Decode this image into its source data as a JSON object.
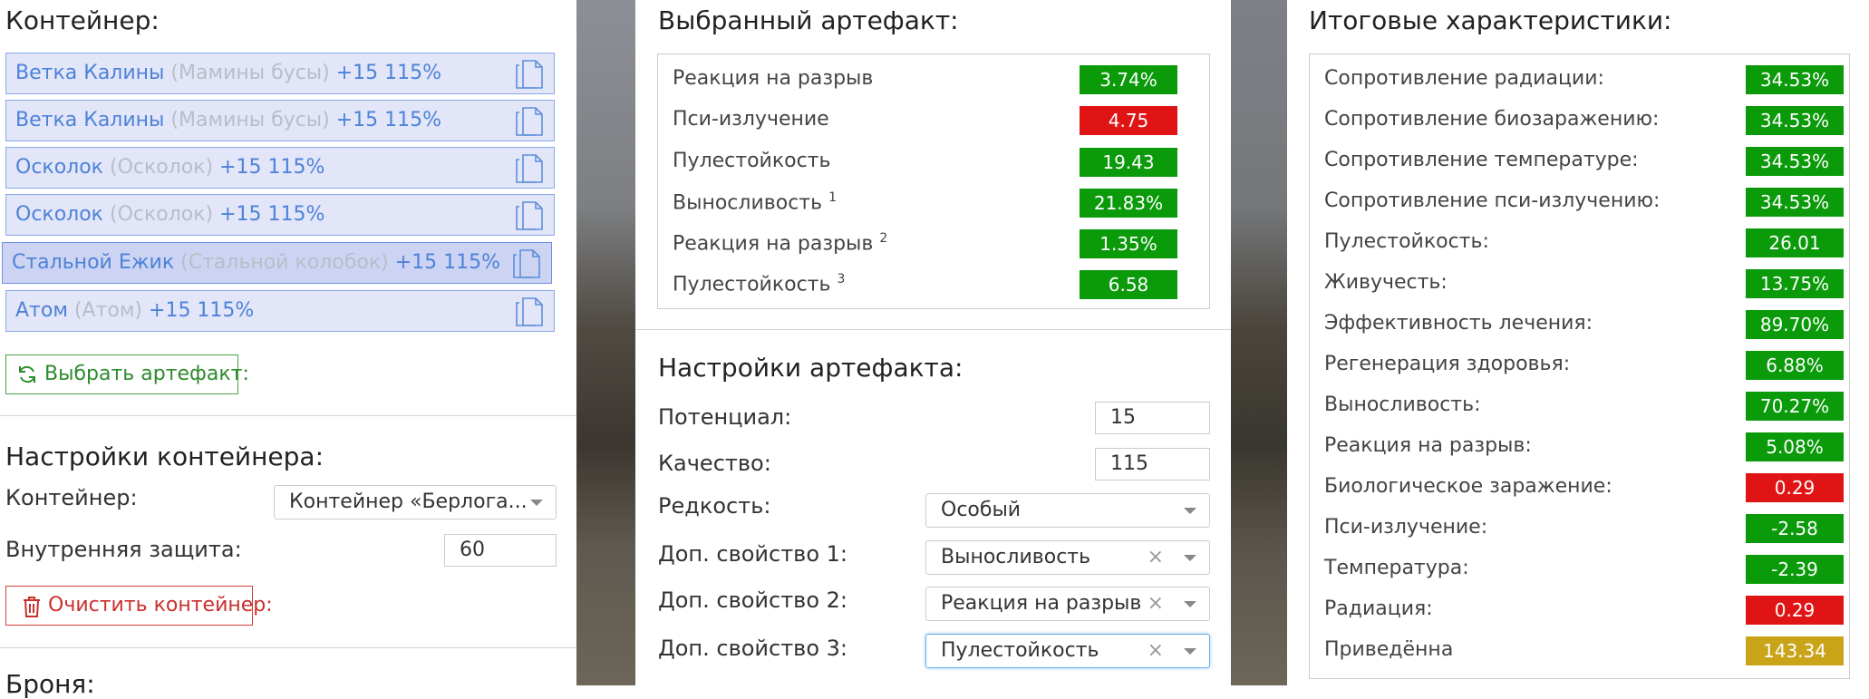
{
  "container": {
    "title": "Контейнер:",
    "items": [
      {
        "name": "Ветка Калины",
        "alt": "(Мамины бусы)",
        "level": "+15 115%"
      },
      {
        "name": "Ветка Калины",
        "alt": "(Мамины бусы)",
        "level": "+15 115%"
      },
      {
        "name": "Осколок",
        "alt": "(Осколок)",
        "level": "+15 115%"
      },
      {
        "name": "Осколок",
        "alt": "(Осколок)",
        "level": "+15 115%"
      },
      {
        "name": "Стальной Ежик",
        "alt": "(Стальной колобок)",
        "level": "+15 115%"
      },
      {
        "name": "Атом",
        "alt": "(Атом)",
        "level": "+15 115%"
      }
    ],
    "select_artifact_btn": "Выбрать артефакт:",
    "settings_title": "Настройки контейнера:",
    "container_label": "Контейнер:",
    "container_value": "Контейнер «Берлога...",
    "inner_protection_label": "Внутренняя защита:",
    "inner_protection_value": "60",
    "clear_btn": "Очистить контейнер:",
    "next_title": "Броня:"
  },
  "selected": {
    "title": "Выбранный артефакт:",
    "rows": [
      {
        "label": "Реакция на разрыв",
        "sup": "",
        "value": "3.74%",
        "color": "#0a9a0a"
      },
      {
        "label": "Пси-излучение",
        "sup": "",
        "value": "4.75",
        "color": "#e01414"
      },
      {
        "label": "Пулестойкость",
        "sup": "",
        "value": "19.43",
        "color": "#0a9a0a"
      },
      {
        "label": "Выносливость",
        "sup": "1",
        "value": "21.83%",
        "color": "#0a9a0a"
      },
      {
        "label": "Реакция на разрыв",
        "sup": "2",
        "value": "1.35%",
        "color": "#0a9a0a"
      },
      {
        "label": "Пулестойкость",
        "sup": "3",
        "value": "6.58",
        "color": "#0a9a0a"
      }
    ]
  },
  "artifact_settings": {
    "title": "Настройки артефакта:",
    "potential_label": "Потенциал:",
    "potential_value": "15",
    "quality_label": "Качество:",
    "quality_value": "115",
    "rarity_label": "Редкость:",
    "rarity_value": "Особый",
    "prop1_label": "Доп. свойство 1:",
    "prop1_value": "Выносливость",
    "prop2_label": "Доп. свойство 2:",
    "prop2_value": "Реакция на разрыв",
    "prop3_label": "Доп. свойство 3:",
    "prop3_value": "Пулестойкость",
    "clear_glyph": "×"
  },
  "totals": {
    "title": "Итоговые характеристики:",
    "rows": [
      {
        "label": "Сопротивление радиации:",
        "value": "34.53%",
        "color": "#0a9a0a"
      },
      {
        "label": "Сопротивление биозаражению:",
        "value": "34.53%",
        "color": "#0a9a0a"
      },
      {
        "label": "Сопротивление температуре:",
        "value": "34.53%",
        "color": "#0a9a0a"
      },
      {
        "label": "Сопротивление пси-излучению:",
        "value": "34.53%",
        "color": "#0a9a0a"
      },
      {
        "label": "Пулестойкость:",
        "value": "26.01",
        "color": "#0a9a0a"
      },
      {
        "label": "Живучесть:",
        "value": "13.75%",
        "color": "#0a9a0a"
      },
      {
        "label": "Эффективность лечения:",
        "value": "89.70%",
        "color": "#0a9a0a"
      },
      {
        "label": "Регенерация здоровья:",
        "value": "6.88%",
        "color": "#0a9a0a"
      },
      {
        "label": "Выносливость:",
        "value": "70.27%",
        "color": "#0a9a0a"
      },
      {
        "label": "Реакция на разрыв:",
        "value": "5.08%",
        "color": "#0a9a0a"
      },
      {
        "label": "Биологическое заражение:",
        "value": "0.29",
        "color": "#e01414"
      },
      {
        "label": "Пси-излучение:",
        "value": "-2.58",
        "color": "#0a9a0a"
      },
      {
        "label": "Температура:",
        "value": "-2.39",
        "color": "#0a9a0a"
      },
      {
        "label": "Радиация:",
        "value": "0.29",
        "color": "#e01414"
      },
      {
        "label": "Приведённа",
        "value": "143.34",
        "color": "#c9a318"
      }
    ]
  }
}
